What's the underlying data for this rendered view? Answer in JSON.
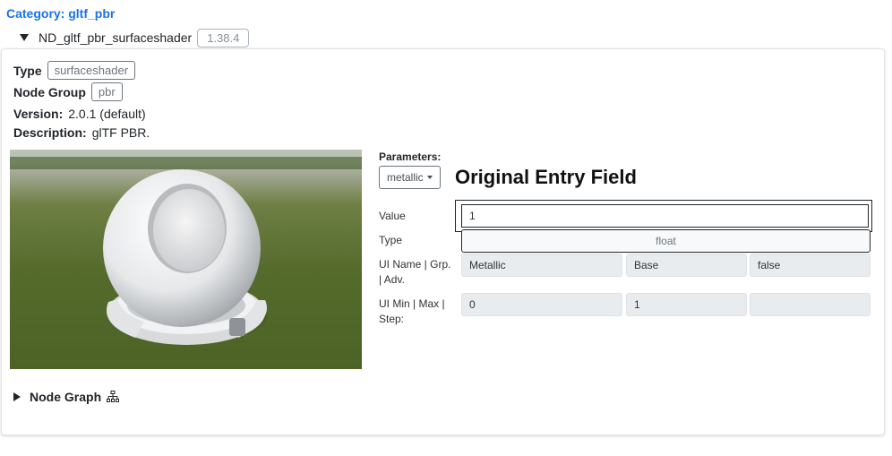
{
  "category_label": "Category: gltf_pbr",
  "node": {
    "name": "ND_gltf_pbr_surfaceshader",
    "version_badge": "1.38.4"
  },
  "meta": {
    "type_label": "Type",
    "type_value": "surfaceshader",
    "group_label": "Node Group",
    "group_value": "pbr",
    "version_label": "Version:",
    "version_value": "2.0.1 (default)",
    "description_label": "Description:",
    "description_value": "glTF PBR."
  },
  "params": {
    "header": "Parameters:",
    "selected": "metallic",
    "entry_title": "Original Entry Field",
    "value_label": "Value",
    "value": "1",
    "type_label": "Type",
    "type": "float",
    "ui_name_label": "UI Name | Grp. | Adv.",
    "ui_name": "Metallic",
    "ui_group": "Base",
    "ui_adv": "false",
    "ui_min_label": "UI Min | Max | Step:",
    "ui_min": "0",
    "ui_max": "1",
    "ui_step": ""
  },
  "node_graph_label": "Node Graph",
  "icons": {
    "expand": "triangle-down-icon",
    "collapse": "triangle-right-icon",
    "graph": "sitemap-icon"
  }
}
